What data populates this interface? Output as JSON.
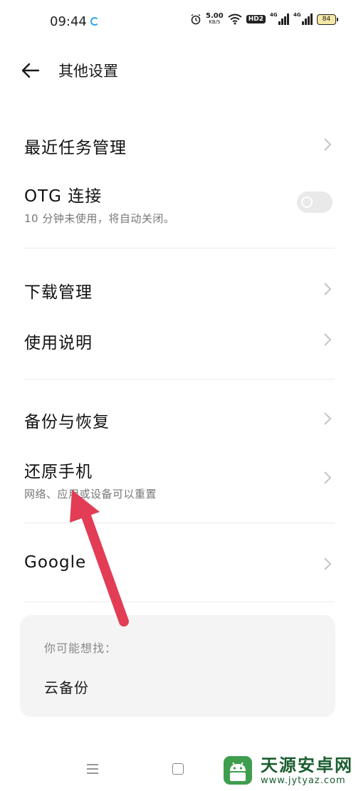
{
  "status_bar": {
    "time": "09:44",
    "speed_value": "5.00",
    "speed_unit": "KB/S",
    "hd_label": "HD2",
    "sim1_label": "4G",
    "sim2_label": "4G",
    "battery": "84"
  },
  "header": {
    "title": "其他设置"
  },
  "items": [
    {
      "title": "最近任务管理"
    },
    {
      "title": "OTG 连接",
      "subtitle": "10 分钟未使用，将自动关闭。",
      "toggle_on": false
    },
    {
      "title": "下载管理"
    },
    {
      "title": "使用说明"
    },
    {
      "title": "备份与恢复"
    },
    {
      "title": "还原手机",
      "subtitle": "网络、应用或设备可以重置"
    },
    {
      "title": "Google"
    }
  ],
  "suggestions": {
    "heading": "你可能想找：",
    "items": [
      "云备份"
    ]
  },
  "watermark": {
    "name": "天源安卓网",
    "url": "www.jytyaz.com"
  },
  "colors": {
    "annotation_arrow": "#e23d55",
    "toggle_off": "#e9e9e9",
    "card_bg": "#f4f4f4",
    "watermark": "#1b5d2f"
  }
}
